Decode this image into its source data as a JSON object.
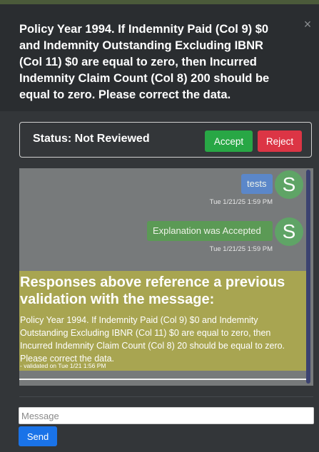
{
  "header": {
    "message": "Policy Year 1994. If Indemnity Paid (Col 9) $0 and Indemnity Outstanding Excluding IBNR (Col 11) $0 are equal to zero, then Incurred Indemnity Claim Count (Col 8) 200 should be equal to zero. Please correct the data.",
    "close_icon": "close-icon"
  },
  "status": {
    "label": "Status: Not Reviewed",
    "accept_label": "Accept",
    "reject_label": "Reject",
    "colors": {
      "accept": "#28a745",
      "reject": "#dc3545"
    }
  },
  "chat": {
    "messages": [
      {
        "text": "tests",
        "time": "Tue 1/21/25 1:59 PM",
        "avatar": "S",
        "color": "#5b87c9"
      },
      {
        "text": "Explanation was Accepted",
        "time": "Tue 1/21/25 1:59 PM",
        "avatar": "S",
        "color": "#5b9a55"
      }
    ],
    "reference": {
      "title": "Responses above reference a previous validation with the message:",
      "body": "Policy Year 1994. If Indemnity Paid (Col 9) $0 and Indemnity Outstanding Excluding IBNR (Col 11) $0 are equal to zero, then Incurred Indemnity Claim Count (Col 8) 20 should be equal to zero. Please correct the data.",
      "meta": "- validated on Tue 1/21 1:56 PM",
      "color": "#a8a551"
    }
  },
  "composer": {
    "placeholder": "Message",
    "value": "",
    "send_label": "Send"
  }
}
